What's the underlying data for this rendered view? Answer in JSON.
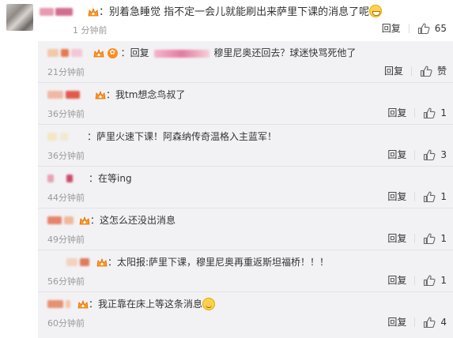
{
  "top_comment": {
    "text": "：别着急睡觉 指不定一会儿就能刷出来萨里下课的消息了呢",
    "time": "1 分钟前",
    "emoji_icon": "grinning-face-icon",
    "reply_label": "回复",
    "likes": "65"
  },
  "replies": [
    {
      "text": "：回复",
      "text2": "穆里尼奥还回去？球迷快骂死他了",
      "time": "21分钟前",
      "like_label": "赞",
      "reply_label": "回复"
    },
    {
      "text": "：我tm想念鸟叔了",
      "time": "36分钟前",
      "likes": "1",
      "reply_label": "回复"
    },
    {
      "text": "：萨里火速下课！阿森纳传奇温格入主蓝军！",
      "time": "36分钟前",
      "likes": "3",
      "reply_label": "回复"
    },
    {
      "text": "：在等ing",
      "time": "44分钟前",
      "likes": "1",
      "reply_label": "回复"
    },
    {
      "text": "：这怎么还没出消息",
      "time": "49分钟前",
      "likes": "1",
      "reply_label": "回复"
    },
    {
      "text": "：太阳报:萨里下课，穆里尼奥再重返斯坦福桥！！！",
      "time": "56分钟前",
      "likes": "1",
      "reply_label": "回复"
    },
    {
      "text": "：我正靠在床上等这条消息",
      "time": "60分钟前",
      "likes": "4",
      "reply_label": "回复",
      "emoji_icon": "smiling-face-icon"
    }
  ],
  "colors": {
    "panel_bg": "#f2f2f5",
    "muted": "#999999",
    "crown": "#ff8c1a"
  }
}
